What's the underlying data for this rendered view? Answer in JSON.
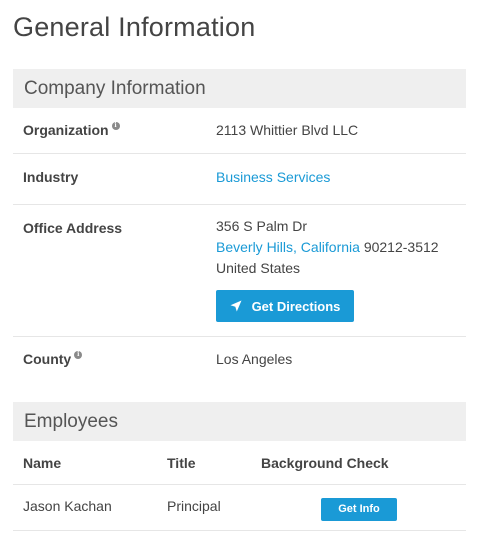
{
  "page": {
    "title": "General Information"
  },
  "company": {
    "section_title": "Company Information",
    "organization": {
      "label": "Organization",
      "value": "2113 Whittier Blvd LLC"
    },
    "industry": {
      "label": "Industry",
      "value": "Business Services"
    },
    "office_address": {
      "label": "Office Address",
      "street": "356 S Palm Dr",
      "city": "Beverly Hills",
      "separator": ", ",
      "state": "California",
      "zip": " 90212-3512",
      "country": "United States",
      "directions_label": "Get Directions"
    },
    "county": {
      "label": "County",
      "value": "Los Angeles"
    },
    "info_icon_glyph": "i"
  },
  "employees": {
    "section_title": "Employees",
    "columns": {
      "name": "Name",
      "title": "Title",
      "background_check": "Background Check"
    },
    "rows": [
      {
        "name": "Jason Kachan",
        "title": "Principal",
        "action_label": "Get Info"
      }
    ]
  },
  "colors": {
    "accent": "#1a9ad6",
    "section_bg": "#efefef",
    "divider": "#e6e6e6"
  },
  "icons": {
    "info": "info-circle-icon",
    "directions": "navigation-arrow-icon"
  }
}
